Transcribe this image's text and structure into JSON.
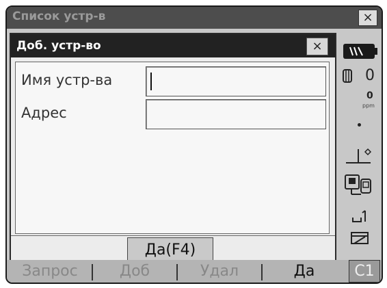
{
  "background_window": {
    "title": "Список устр-в",
    "close_glyph": "×"
  },
  "dialog": {
    "title": "Доб. устр-во",
    "close_glyph": "×",
    "fields": [
      {
        "label": "Имя устр-ва",
        "value": ""
      },
      {
        "label": "Адрес",
        "value": ""
      }
    ],
    "ok_label": "Да(F4)"
  },
  "status": {
    "battery_icon": "battery-icon",
    "prism_constant": "0",
    "ppm_value": "0",
    "ppm_unit": "ppm"
  },
  "function_keys": [
    {
      "label": "Запрос",
      "active": false
    },
    {
      "label": "Доб",
      "active": false
    },
    {
      "label": "Удал",
      "active": false
    },
    {
      "label": "Да",
      "active": true
    }
  ],
  "mode_button": "C1"
}
